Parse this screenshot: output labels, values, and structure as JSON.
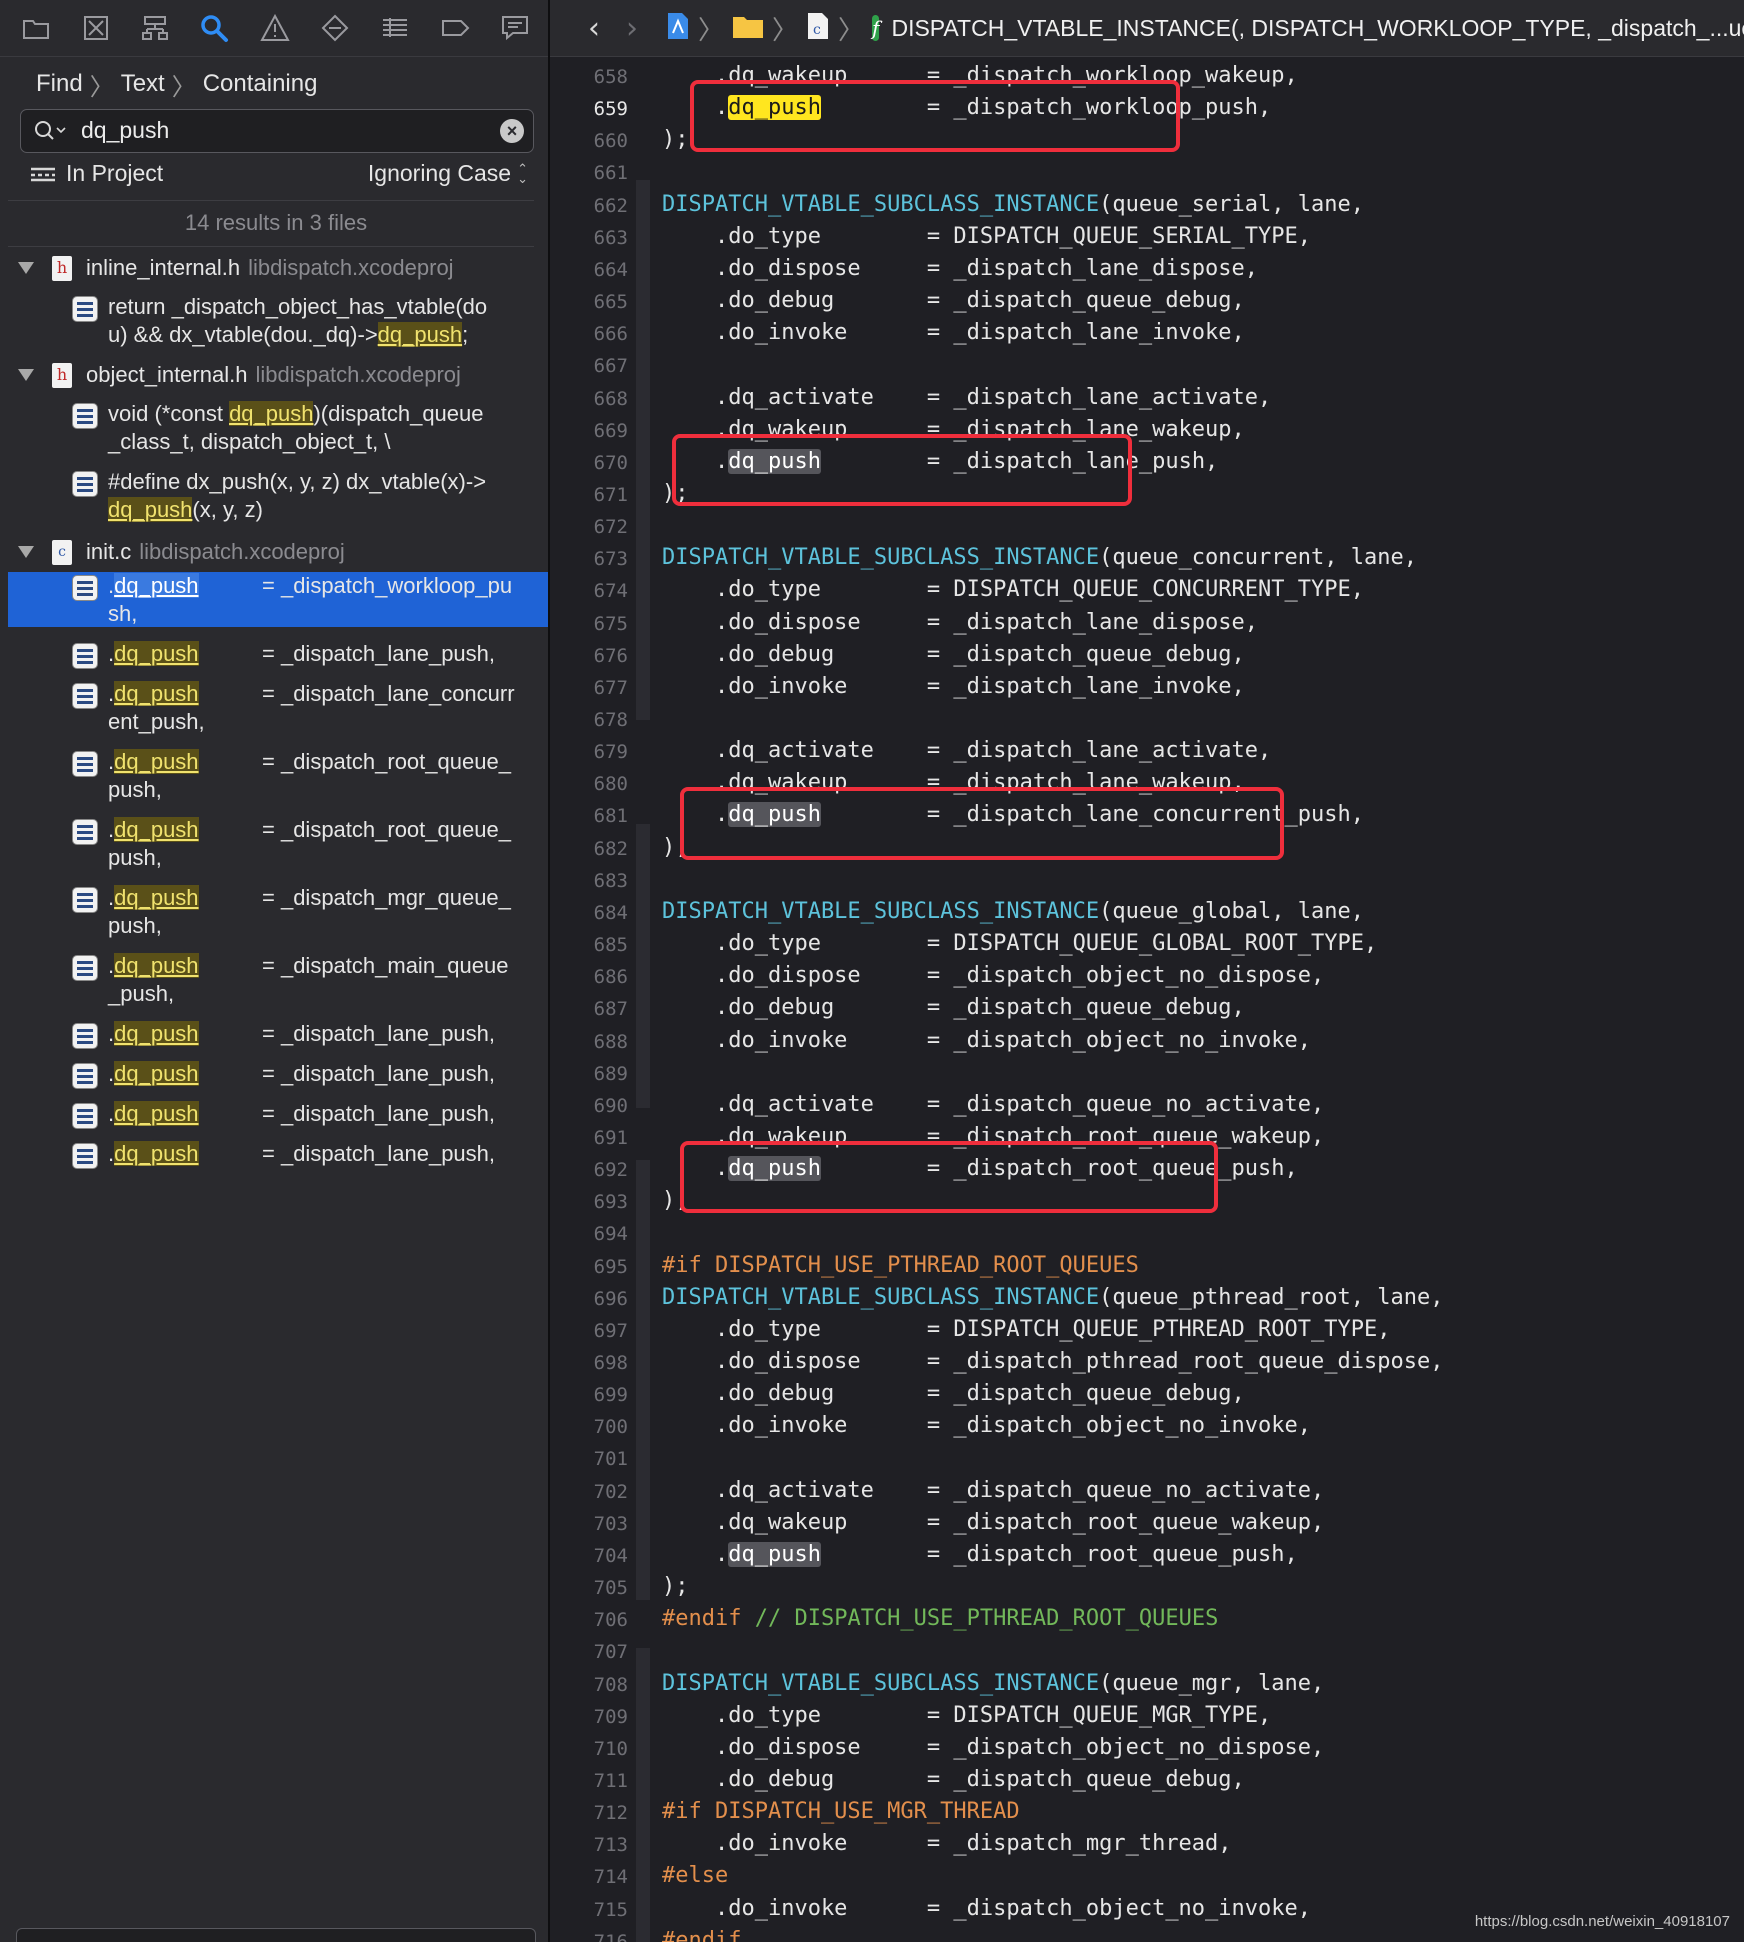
{
  "navigator": {
    "tabs": [
      "folder-icon",
      "source-control-icon",
      "symbol-hierarchy-icon",
      "find-icon",
      "warning-icon",
      "test-diamond-icon",
      "debug-list-icon",
      "breakpoint-tag-icon",
      "report-bubble-icon"
    ],
    "breadcrumb": [
      "Find",
      "Text",
      "Containing"
    ],
    "search_value": "dq_push",
    "scope": "In Project",
    "case_mode": "Ignoring Case",
    "summary": "14 results in 3 files",
    "files": [
      {
        "name": "inline_internal.h",
        "project": "libdispatch.xcodeproj",
        "type": "h"
      },
      {
        "name": "object_internal.h",
        "project": "libdispatch.xcodeproj",
        "type": "h"
      },
      {
        "name": "init.c",
        "project": "libdispatch.xcodeproj",
        "type": "c"
      }
    ],
    "results_text": {
      "r1a": "return _dispatch_object_has_vtable(do",
      "r1b": "u) && dx_vtable(dou._dq)->",
      "r1c": ";",
      "r2a": "void (*const ",
      "r2b": ")(dispatch_queue",
      "r2c": "_class_t, dispatch_object_t, \\",
      "r3a": "#define dx_push(x, y, z) dx_vtable(x)->",
      "r3b": "(x, y, z)",
      "match": "dq_push",
      "dot": "."
    },
    "init_results": [
      {
        "a": "= _dispatch_workloop_pu",
        "b": "sh,"
      },
      {
        "a": "= _dispatch_lane_push,",
        "b": ""
      },
      {
        "a": "= _dispatch_lane_concurr",
        "b": "ent_push,"
      },
      {
        "a": "= _dispatch_root_queue_",
        "b": "push,"
      },
      {
        "a": "= _dispatch_root_queue_",
        "b": "push,"
      },
      {
        "a": "= _dispatch_mgr_queue_",
        "b": "push,"
      },
      {
        "a": "= _dispatch_main_queue",
        "b": "_push,"
      },
      {
        "a": "= _dispatch_lane_push,",
        "b": ""
      },
      {
        "a": "= _dispatch_lane_push,",
        "b": ""
      },
      {
        "a": "= _dispatch_lane_push,",
        "b": ""
      },
      {
        "a": "= _dispatch_lane_push,",
        "b": ""
      }
    ]
  },
  "editor": {
    "jump_symbol": "DISPATCH_VTABLE_INSTANCE(, DISPATCH_WORKLOOP_TYPE, _dispatch_...ueue",
    "current_line": "659",
    "lines": [
      {
        "n": "658",
        "t": "    .dq_wakeup      = _dispatch_workloop_wakeup,"
      },
      {
        "n": "659",
        "t": "    .dq_push        = _dispatch_workloop_push,"
      },
      {
        "n": "660",
        "t": ");"
      },
      {
        "n": "661",
        "t": ""
      },
      {
        "n": "662",
        "t": "DISPATCH_VTABLE_SUBCLASS_INSTANCE(queue_serial, lane,"
      },
      {
        "n": "663",
        "t": "    .do_type        = DISPATCH_QUEUE_SERIAL_TYPE,"
      },
      {
        "n": "664",
        "t": "    .do_dispose     = _dispatch_lane_dispose,"
      },
      {
        "n": "665",
        "t": "    .do_debug       = _dispatch_queue_debug,"
      },
      {
        "n": "666",
        "t": "    .do_invoke      = _dispatch_lane_invoke,"
      },
      {
        "n": "667",
        "t": ""
      },
      {
        "n": "668",
        "t": "    .dq_activate    = _dispatch_lane_activate,"
      },
      {
        "n": "669",
        "t": "    .dq_wakeup      = _dispatch_lane_wakeup,"
      },
      {
        "n": "670",
        "t": "    .dq_push        = _dispatch_lane_push,"
      },
      {
        "n": "671",
        "t": ");"
      },
      {
        "n": "672",
        "t": ""
      },
      {
        "n": "673",
        "t": "DISPATCH_VTABLE_SUBCLASS_INSTANCE(queue_concurrent, lane,"
      },
      {
        "n": "674",
        "t": "    .do_type        = DISPATCH_QUEUE_CONCURRENT_TYPE,"
      },
      {
        "n": "675",
        "t": "    .do_dispose     = _dispatch_lane_dispose,"
      },
      {
        "n": "676",
        "t": "    .do_debug       = _dispatch_queue_debug,"
      },
      {
        "n": "677",
        "t": "    .do_invoke      = _dispatch_lane_invoke,"
      },
      {
        "n": "678",
        "t": ""
      },
      {
        "n": "679",
        "t": "    .dq_activate    = _dispatch_lane_activate,"
      },
      {
        "n": "680",
        "t": "    .dq_wakeup      = _dispatch_lane_wakeup,"
      },
      {
        "n": "681",
        "t": "    .dq_push        = _dispatch_lane_concurrent_push,"
      },
      {
        "n": "682",
        "t": ");"
      },
      {
        "n": "683",
        "t": ""
      },
      {
        "n": "684",
        "t": "DISPATCH_VTABLE_SUBCLASS_INSTANCE(queue_global, lane,"
      },
      {
        "n": "685",
        "t": "    .do_type        = DISPATCH_QUEUE_GLOBAL_ROOT_TYPE,"
      },
      {
        "n": "686",
        "t": "    .do_dispose     = _dispatch_object_no_dispose,"
      },
      {
        "n": "687",
        "t": "    .do_debug       = _dispatch_queue_debug,"
      },
      {
        "n": "688",
        "t": "    .do_invoke      = _dispatch_object_no_invoke,"
      },
      {
        "n": "689",
        "t": ""
      },
      {
        "n": "690",
        "t": "    .dq_activate    = _dispatch_queue_no_activate,"
      },
      {
        "n": "691",
        "t": "    .dq_wakeup      = _dispatch_root_queue_wakeup,"
      },
      {
        "n": "692",
        "t": "    .dq_push        = _dispatch_root_queue_push,"
      },
      {
        "n": "693",
        "t": ");"
      },
      {
        "n": "694",
        "t": ""
      },
      {
        "n": "695",
        "t": "#if DISPATCH_USE_PTHREAD_ROOT_QUEUES"
      },
      {
        "n": "696",
        "t": "DISPATCH_VTABLE_SUBCLASS_INSTANCE(queue_pthread_root, lane,"
      },
      {
        "n": "697",
        "t": "    .do_type        = DISPATCH_QUEUE_PTHREAD_ROOT_TYPE,"
      },
      {
        "n": "698",
        "t": "    .do_dispose     = _dispatch_pthread_root_queue_dispose,"
      },
      {
        "n": "699",
        "t": "    .do_debug       = _dispatch_queue_debug,"
      },
      {
        "n": "700",
        "t": "    .do_invoke      = _dispatch_object_no_invoke,"
      },
      {
        "n": "701",
        "t": ""
      },
      {
        "n": "702",
        "t": "    .dq_activate    = _dispatch_queue_no_activate,"
      },
      {
        "n": "703",
        "t": "    .dq_wakeup      = _dispatch_root_queue_wakeup,"
      },
      {
        "n": "704",
        "t": "    .dq_push        = _dispatch_root_queue_push,"
      },
      {
        "n": "705",
        "t": ");"
      },
      {
        "n": "706",
        "t": "#endif // DISPATCH_USE_PTHREAD_ROOT_QUEUES"
      },
      {
        "n": "707",
        "t": ""
      },
      {
        "n": "708",
        "t": "DISPATCH_VTABLE_SUBCLASS_INSTANCE(queue_mgr, lane,"
      },
      {
        "n": "709",
        "t": "    .do_type        = DISPATCH_QUEUE_MGR_TYPE,"
      },
      {
        "n": "710",
        "t": "    .do_dispose     = _dispatch_object_no_dispose,"
      },
      {
        "n": "711",
        "t": "    .do_debug       = _dispatch_queue_debug,"
      },
      {
        "n": "712",
        "t": "#if DISPATCH_USE_MGR_THREAD"
      },
      {
        "n": "713",
        "t": "    .do_invoke      = _dispatch_mgr_thread,"
      },
      {
        "n": "714",
        "t": "#else"
      },
      {
        "n": "715",
        "t": "    .do_invoke      = _dispatch_object_no_invoke,"
      },
      {
        "n": "716",
        "t": "#endif"
      }
    ]
  },
  "watermark": "https://blog.csdn.net/weixin_40918107",
  "colors": {
    "accent": "#1f63d6",
    "match_highlight": "#ffe61f",
    "annotation_box": "#ef2e3c",
    "macro": "#5dc3dc",
    "preprocessor": "#e38f4c",
    "comment": "#72b85a"
  }
}
